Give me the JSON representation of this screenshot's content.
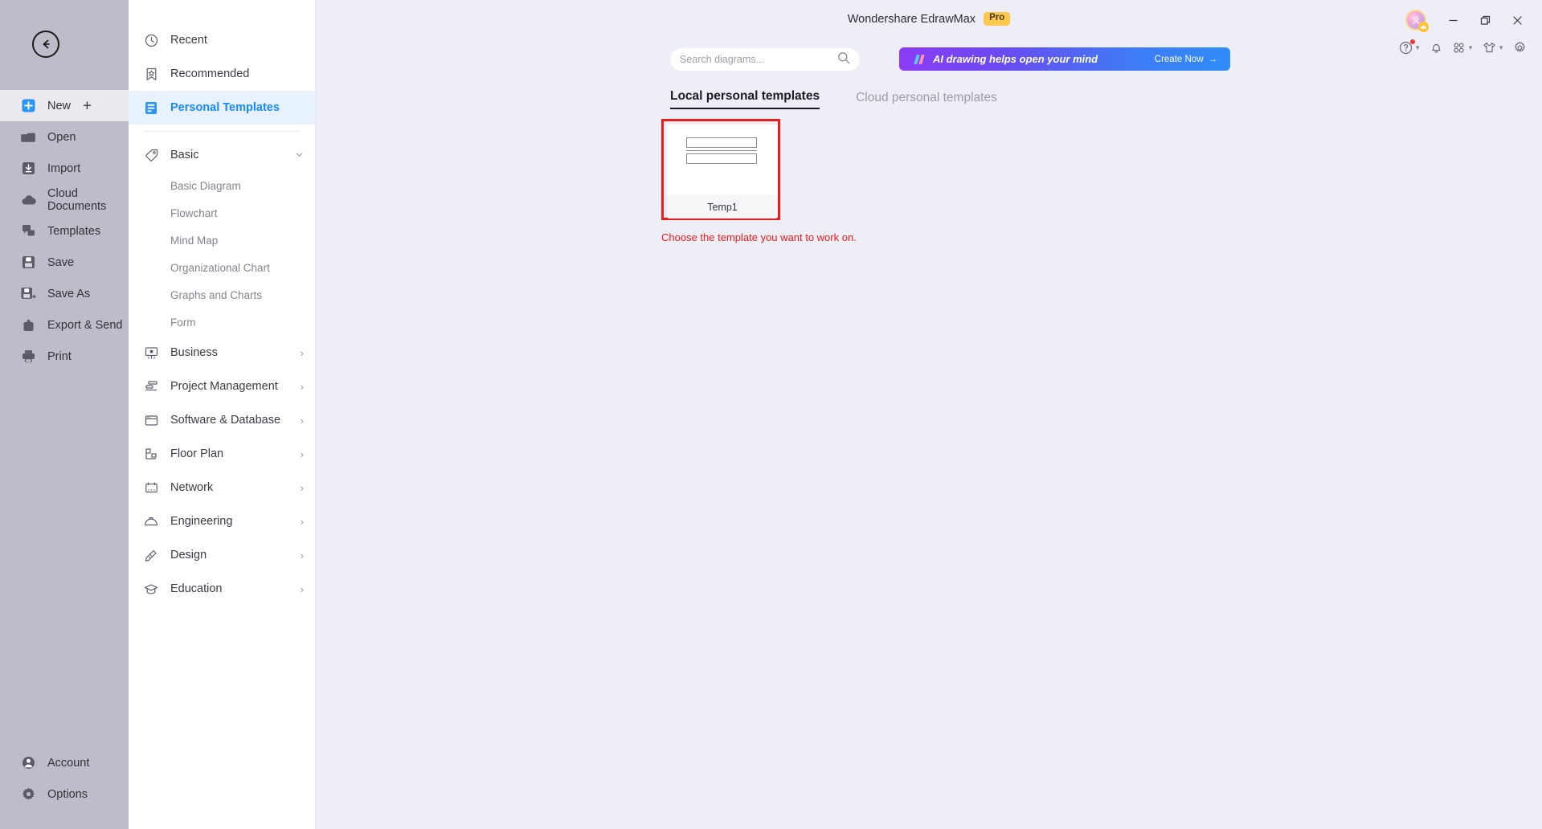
{
  "window": {
    "app_title": "Wondershare EdrawMax",
    "pro_badge": "Pro",
    "minimize_label": "Minimize",
    "restore_label": "Restore",
    "close_label": "Close"
  },
  "rail": {
    "back_label": "Back",
    "items": [
      {
        "label": "New",
        "icon": "plus-square-icon",
        "selected": true,
        "trailing": "+"
      },
      {
        "label": "Open",
        "icon": "folder-icon",
        "selected": false
      },
      {
        "label": "Import",
        "icon": "import-icon",
        "selected": false
      },
      {
        "label": "Cloud Documents",
        "icon": "cloud-icon",
        "selected": false
      },
      {
        "label": "Templates",
        "icon": "templates-icon",
        "selected": false
      },
      {
        "label": "Save",
        "icon": "save-icon",
        "selected": false
      },
      {
        "label": "Save As",
        "icon": "save-as-icon",
        "selected": false
      },
      {
        "label": "Export & Send",
        "icon": "export-send-icon",
        "selected": false
      },
      {
        "label": "Print",
        "icon": "print-icon",
        "selected": false
      }
    ],
    "bottom_items": [
      {
        "label": "Account",
        "icon": "account-icon"
      },
      {
        "label": "Options",
        "icon": "gear-icon"
      }
    ]
  },
  "categories": {
    "top": [
      {
        "label": "Recent",
        "icon": "clock-icon",
        "active": false
      },
      {
        "label": "Recommended",
        "icon": "bookmark-star-icon",
        "active": false
      },
      {
        "label": "Personal Templates",
        "icon": "personal-templates-icon",
        "active": true
      }
    ],
    "groups": [
      {
        "label": "Basic",
        "icon": "tag-icon",
        "expanded": true,
        "chevron": "chevron-down-icon",
        "children": [
          "Basic Diagram",
          "Flowchart",
          "Mind Map",
          "Organizational Chart",
          "Graphs and Charts",
          "Form"
        ]
      },
      {
        "label": "Business",
        "icon": "presentation-icon",
        "expanded": false,
        "chevron": "chevron-right-icon",
        "children": []
      },
      {
        "label": "Project Management",
        "icon": "gantt-icon",
        "expanded": false,
        "chevron": "chevron-right-icon",
        "children": []
      },
      {
        "label": "Software & Database",
        "icon": "window-icon",
        "expanded": false,
        "chevron": "chevron-right-icon",
        "children": []
      },
      {
        "label": "Floor Plan",
        "icon": "floorplan-icon",
        "expanded": false,
        "chevron": "chevron-right-icon",
        "children": []
      },
      {
        "label": "Network",
        "icon": "network-icon",
        "expanded": false,
        "chevron": "chevron-right-icon",
        "children": []
      },
      {
        "label": "Engineering",
        "icon": "helmet-icon",
        "expanded": false,
        "chevron": "chevron-right-icon",
        "children": []
      },
      {
        "label": "Design",
        "icon": "design-icon",
        "expanded": false,
        "chevron": "chevron-right-icon",
        "children": []
      },
      {
        "label": "Education",
        "icon": "graduation-icon",
        "expanded": false,
        "chevron": "chevron-right-icon",
        "children": []
      }
    ]
  },
  "search": {
    "placeholder": "Search diagrams...",
    "value": "",
    "icon": "search-icon"
  },
  "ai_banner": {
    "text": "AI drawing helps open your mind",
    "cta": "Create Now",
    "cta_arrow": "→",
    "logo_icon": "ai-slashes-icon"
  },
  "tabs": [
    {
      "label": "Local personal templates",
      "active": true
    },
    {
      "label": "Cloud personal templates",
      "active": false
    }
  ],
  "templates": [
    {
      "name": "Temp1",
      "selected": true
    }
  ],
  "hint": "Choose the template you want to work on.",
  "util_icons": [
    {
      "name": "help-icon",
      "caret": true,
      "badge": true
    },
    {
      "name": "notification-icon",
      "caret": false,
      "badge": false
    },
    {
      "name": "apps-grid-icon",
      "caret": true,
      "badge": false
    },
    {
      "name": "theme-shirt-icon",
      "caret": true,
      "badge": false
    },
    {
      "name": "settings-gear-icon",
      "caret": false,
      "badge": false
    }
  ],
  "colors": {
    "rail_bg": "#bcbdc8",
    "panel_bg": "#ffffff",
    "content_bg": "#eeeef7",
    "accent_blue": "#1989fa",
    "highlight_red": "#ee1b1b",
    "pro_yellow": "#fcc84d"
  }
}
